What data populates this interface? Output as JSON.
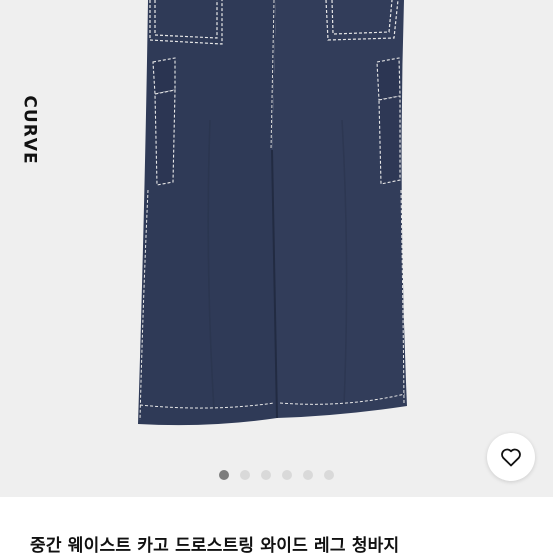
{
  "product": {
    "badge_text": "CURVE",
    "title": "중간 웨이스트 카고 드로스트링 와이드 레그 청바지",
    "image_count": 6,
    "active_image": 1,
    "colors": {
      "denim": "#2f3a57",
      "stitch": "#e8e8e8",
      "background": "#efefef"
    }
  },
  "actions": {
    "favorite_icon": "heart-icon"
  }
}
